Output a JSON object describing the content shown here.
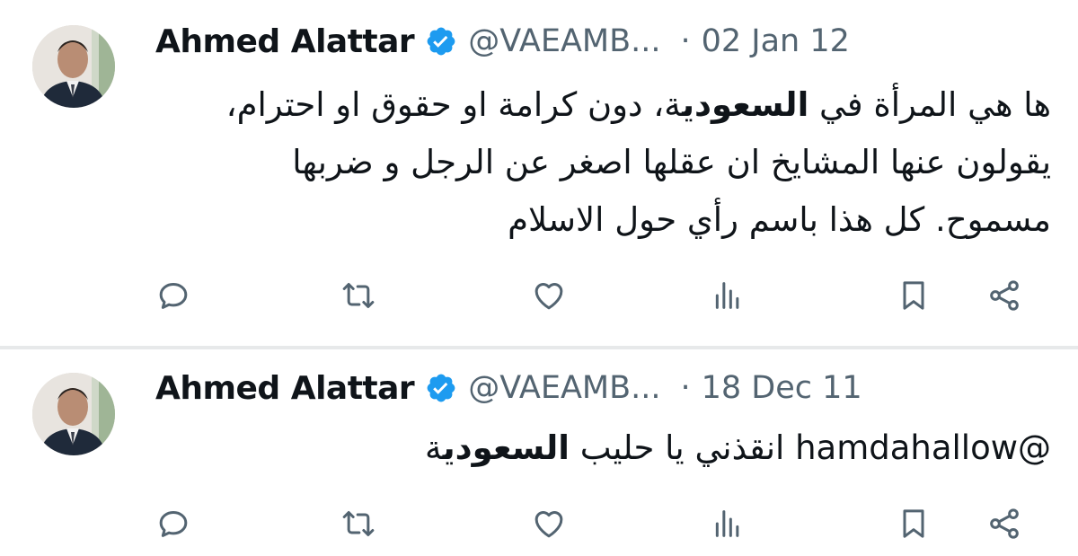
{
  "colors": {
    "text": "#0f1419",
    "muted": "#536471",
    "verified": "#1d9bf0",
    "divider": "#e7e9ea"
  },
  "tweets": [
    {
      "author_name": "Ahmed Alattar",
      "handle": "@VAEAMB...",
      "separator": "·",
      "date": "02 Jan 12",
      "text_line1_pre": "ها هي المرأة في ",
      "text_line1_bold": "السعودي",
      "text_line1_post": "ة، دون كرامة او حقوق او احترام،",
      "text_line2": "يقولون عنها المشايخ ان عقلها اصغر عن الرجل و ضربها",
      "text_line3": "مسموح. كل هذا باسم رأي حول الاسلام",
      "icons": [
        "reply-icon",
        "retweet-icon",
        "like-icon",
        "views-icon",
        "bookmark-icon",
        "share-icon"
      ]
    },
    {
      "author_name": "Ahmed Alattar",
      "handle": "@VAEAMB...",
      "separator": "·",
      "date": "18 Dec 11",
      "text_mention": "@hamdahallow",
      "text_pre": " انقذني يا حليب ",
      "text_bold": "السعودي",
      "text_post": "ة",
      "icons": [
        "reply-icon",
        "retweet-icon",
        "like-icon",
        "views-icon",
        "bookmark-icon",
        "share-icon"
      ]
    }
  ]
}
